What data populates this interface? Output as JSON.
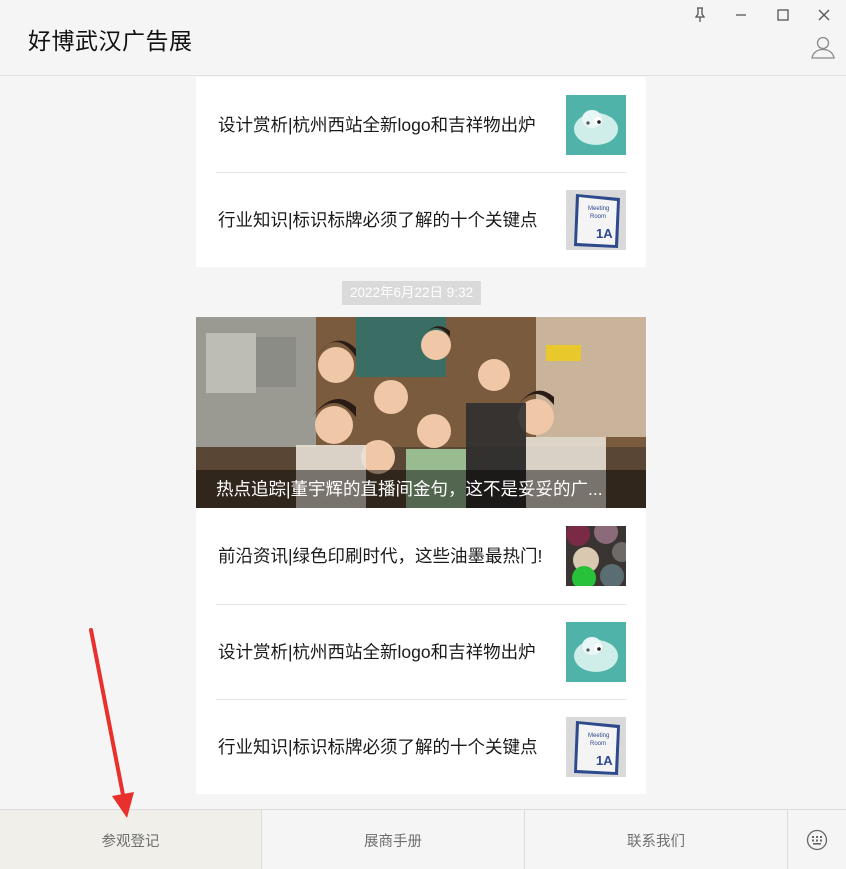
{
  "app": {
    "title": "好博武汉广告展"
  },
  "window_controls": [
    "pin-icon",
    "minimize-icon",
    "maximize-icon",
    "close-icon"
  ],
  "feed": {
    "top_card": [
      {
        "title": "设计赏析|杭州西站全新logo和吉祥物出炉",
        "thumb": "mascot-thumbnail"
      },
      {
        "title": "行业知识|标识标牌必须了解的十个关键点",
        "thumb": "meeting-room-sign-thumbnail"
      }
    ],
    "timestamp": "2022年6月22日  9:32",
    "second_card": {
      "hero_title": "热点追踪|董宇辉的直播间金句，这不是妥妥的广...",
      "items": [
        {
          "title": "前沿资讯|绿色印刷时代，这些油墨最热门!",
          "thumb": "ink-paint-thumbnail"
        },
        {
          "title": "设计赏析|杭州西站全新logo和吉祥物出炉",
          "thumb": "mascot-thumbnail"
        },
        {
          "title": "行业知识|标识标牌必须了解的十个关键点",
          "thumb": "meeting-room-sign-thumbnail"
        }
      ]
    }
  },
  "sign_text": {
    "line1": "Meeting",
    "line2": "Room",
    "line3": "1A"
  },
  "bottom_menu": [
    "参观登记",
    "展商手册",
    "联系我们"
  ],
  "colors": {
    "annotation_arrow": "#e8302c",
    "timestamp_bg": "#dadada"
  }
}
